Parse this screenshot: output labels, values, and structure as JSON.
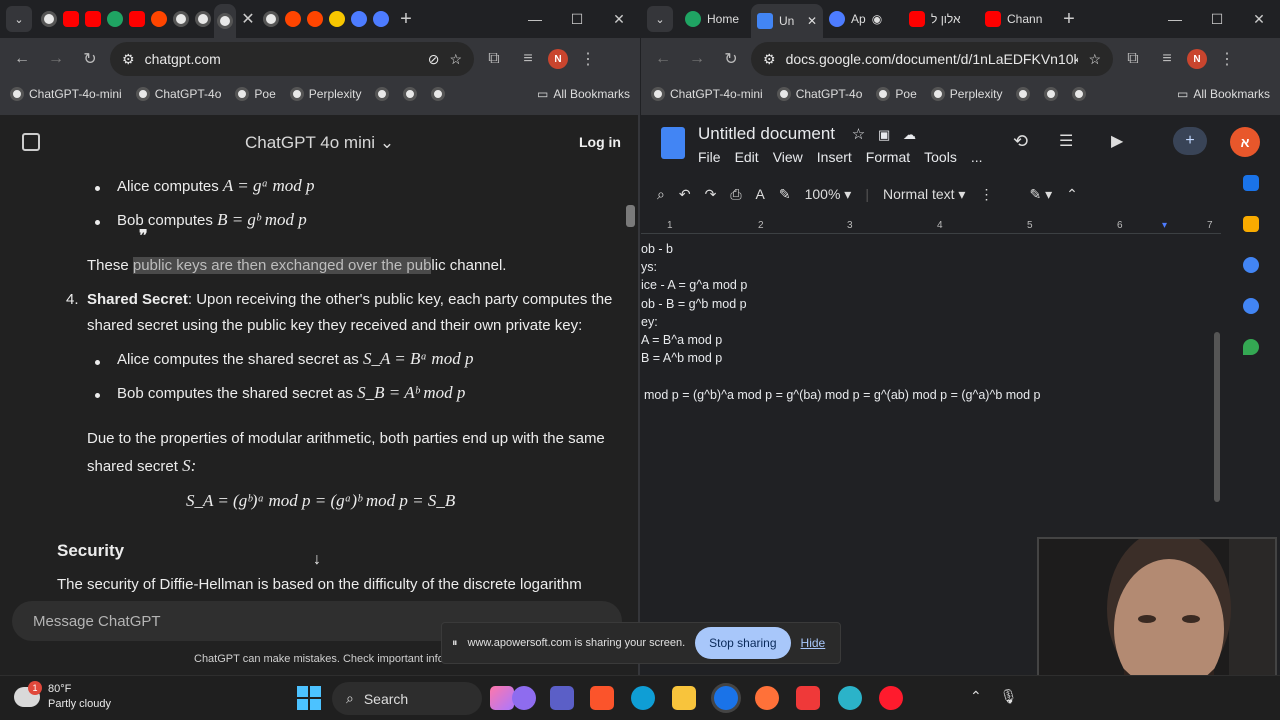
{
  "left_window": {
    "tabs_icons": [
      "chatgpt-favicon",
      "youtube-favicon",
      "youtube-favicon",
      "drive-favicon",
      "youtube-favicon",
      "reddit-favicon",
      "chatgpt-favicon",
      "chatgpt-favicon",
      "chatgpt-favicon"
    ],
    "active_tab_close": "✕",
    "group2_icons": [
      "chatgpt-favicon",
      "reddit-favicon",
      "reddit-favicon",
      "emoji-favicon",
      "tracker-favicon",
      "tracker-favicon"
    ],
    "url": "chatgpt.com",
    "bookmarks": [
      "ChatGPT-4o-mini",
      "ChatGPT-4o",
      "Poe",
      "Perplexity"
    ],
    "all_bookmarks": "All Bookmarks"
  },
  "right_window": {
    "tabs": [
      {
        "label": "Home",
        "icon": "drive-favicon"
      },
      {
        "label": "Un",
        "icon": "docs-favicon"
      },
      {
        "label": "Ap",
        "icon": "apowersoft-favicon"
      },
      {
        "label": "אלון ל",
        "icon": "youtube-favicon"
      },
      {
        "label": "Chann",
        "icon": "youtube-favicon"
      }
    ],
    "url": "docs.google.com/document/d/1nLaEDFKVn10k...",
    "bookmarks": [
      "ChatGPT-4o-mini",
      "ChatGPT-4o",
      "Poe",
      "Perplexity"
    ],
    "all_bookmarks": "All Bookmarks"
  },
  "chatgpt": {
    "title": "ChatGPT 4o mini",
    "login": "Log in",
    "bullet_alice_pub_prefix": "Alice computes",
    "bullet_alice_pub_math": "A = gᵃ  mod p",
    "bullet_bob_pub_prefix": "Bob computes",
    "bullet_bob_pub_math": "B = gᵇ  mod p",
    "quote_mark": "❞",
    "exchange_pre": "These",
    "exchange_highlight": "public keys are then exchanged over the pub",
    "exchange_post": "lic channel.",
    "step_number": "4.",
    "step_title": "Shared Secret",
    "step_text_1": ": Upon receiving the other's public key, each party computes the",
    "step_text_2": "shared secret using the public key they received and their own private key:",
    "bullet_alice_sec_prefix": "Alice computes the shared secret as",
    "bullet_alice_sec_math": "S_A = Bᵃ  mod p",
    "bullet_bob_sec_prefix": "Bob computes the shared secret as",
    "bullet_bob_sec_math": "S_B = Aᵇ  mod p",
    "props_line_1": "Due to the properties of modular arithmetic, both parties end up with the same",
    "props_line_2_prefix": "shared secret",
    "props_line_2_math": "S:",
    "equation": "S_A = (gᵇ)ᵃ   mod p = (gᵃ)ᵇ   mod p = S_B",
    "security_heading": "Security",
    "security_text": "The security of Diffie-Hellman is based on the difficulty of the discrete logarithm",
    "scroll_down_icon": "↓",
    "message_placeholder": "Message ChatGPT",
    "footer": "ChatGPT can make mistakes. Check important info."
  },
  "docs": {
    "title": "Untitled document",
    "menu": [
      "File",
      "Edit",
      "View",
      "Insert",
      "Format",
      "Tools",
      "..."
    ],
    "zoom": "100%",
    "style": "Normal text",
    "ruler_marks": [
      "1",
      "2",
      "3",
      "4",
      "5",
      "6",
      "7"
    ],
    "lines": [
      "ob - b",
      "ys:",
      "ice - A = g^a mod p",
      "ob - B = g^b mod p",
      "ey:",
      "A = B^a mod p",
      "B = A^b mod p",
      "mod p = (g^b)^a mod p = g^(ba) mod p = g^(ab) mod p = (g^a)^b mod p"
    ],
    "account_initial": "א"
  },
  "share_bar": {
    "text": "www.apowersoft.com is sharing your screen.",
    "stop": "Stop sharing",
    "hide": "Hide"
  },
  "taskbar": {
    "temp": "80°F",
    "weather": "Partly cloudy",
    "badge": "1",
    "search": "Search"
  },
  "colors": {
    "chat_bg": "#212121",
    "docs_bg": "#202124",
    "accent_blue": "#a8c7fa",
    "avatar_orange": "#c9452e"
  }
}
